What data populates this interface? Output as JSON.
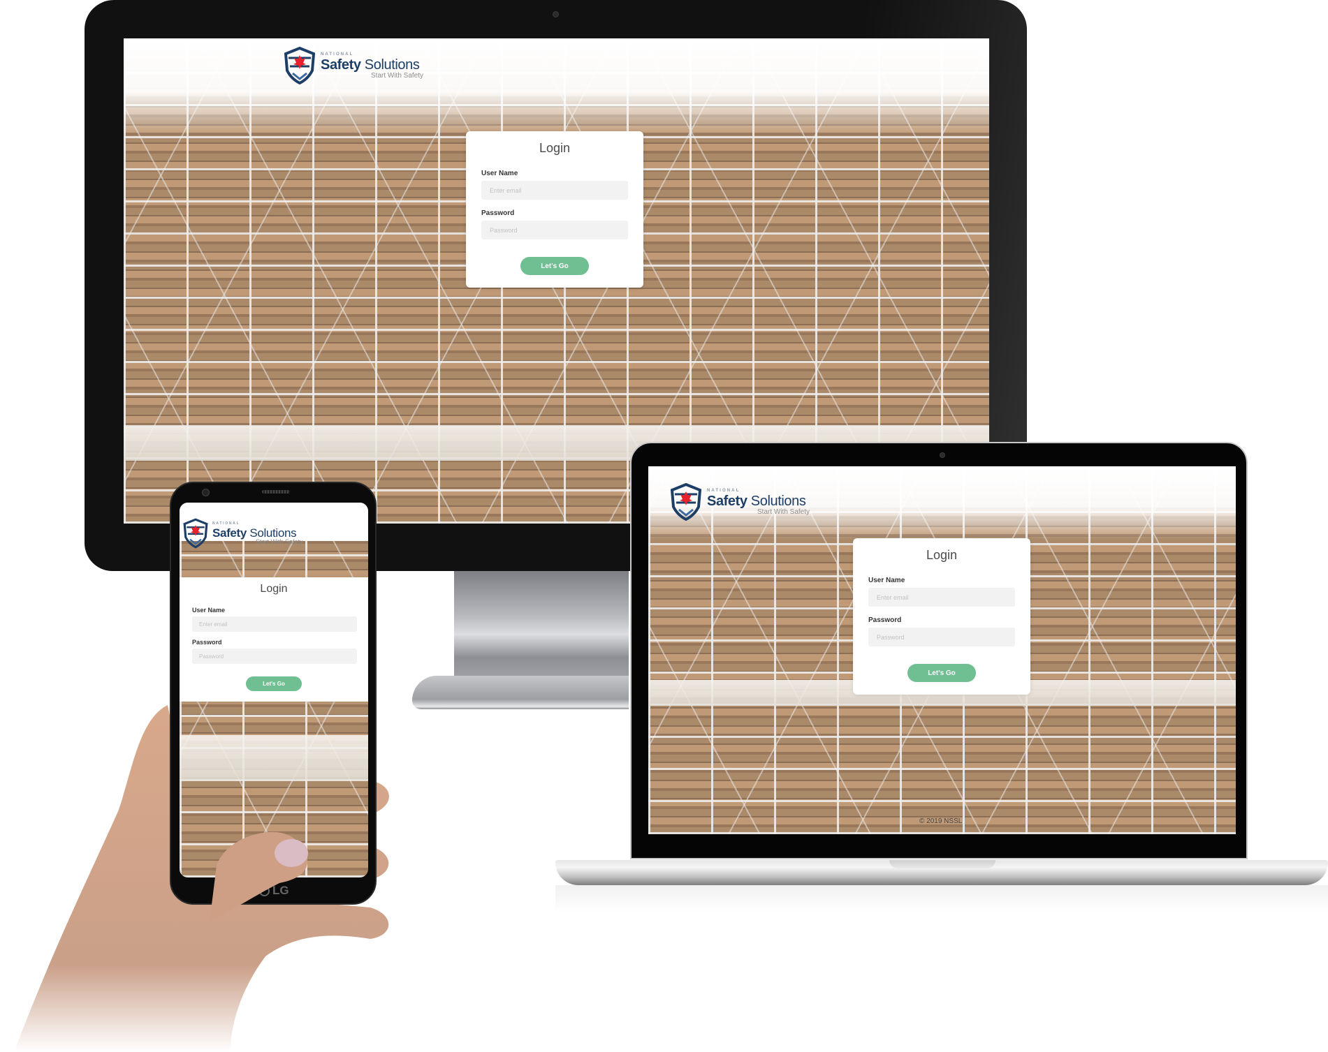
{
  "scene": {
    "description": "Responsive device mockup of login page",
    "devices": [
      "desktop-monitor",
      "laptop",
      "smartphone"
    ]
  },
  "brand": {
    "overline": "NATIONAL",
    "name_bold": "Safety",
    "name_light": " Solutions",
    "tagline": "Start With Safety",
    "colors": {
      "navy": "#1d3e66",
      "maple_red": "#e8212b",
      "gray": "#8b8b8b"
    }
  },
  "login": {
    "title": "Login",
    "username_label": "User Name",
    "username_placeholder": "Enter email",
    "username_value": "",
    "password_label": "Password",
    "password_placeholder": "Password",
    "password_value": "",
    "submit_label": "Let's Go",
    "button_color": "#6fbf93"
  },
  "footer": {
    "copyright": "© 2019 NSSL"
  },
  "phone": {
    "maker_logo": "LG"
  }
}
